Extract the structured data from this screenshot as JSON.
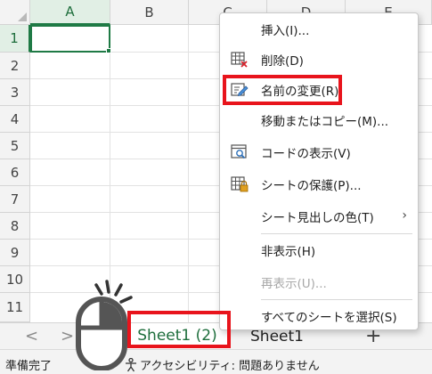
{
  "columns": [
    "A",
    "B",
    "C",
    "D",
    "E"
  ],
  "rows": [
    "1",
    "2",
    "3",
    "4",
    "5",
    "6",
    "7",
    "8",
    "9",
    "10",
    "11"
  ],
  "active_cell": "A1",
  "sheet_tabs": {
    "nav_prev": "<",
    "nav_next": ">",
    "active_tab": "Sheet1 (2)",
    "other_tab": "Sheet1",
    "add_label": "+"
  },
  "status_bar": {
    "ready": "準備完了",
    "accessibility": "アクセシビリティ: 問題ありません"
  },
  "context_menu": {
    "items": [
      {
        "label": "挿入(I)...",
        "icon": "none",
        "enabled": true
      },
      {
        "label": "削除(D)",
        "icon": "delete-sheet-icon",
        "enabled": true
      },
      {
        "label": "名前の変更(R)",
        "icon": "rename-icon",
        "enabled": true
      },
      {
        "label": "移動またはコピー(M)...",
        "icon": "none",
        "enabled": true
      },
      {
        "label": "コードの表示(V)",
        "icon": "view-code-icon",
        "enabled": true
      },
      {
        "label": "シートの保護(P)...",
        "icon": "protect-sheet-icon",
        "enabled": true
      },
      {
        "label": "シート見出しの色(T)",
        "icon": "none",
        "enabled": true,
        "submenu": true
      },
      {
        "label": "非表示(H)",
        "icon": "none",
        "enabled": true
      },
      {
        "label": "再表示(U)...",
        "icon": "none",
        "enabled": false
      },
      {
        "label": "すべてのシートを選択(S)",
        "icon": "none",
        "enabled": true
      }
    ],
    "submenu_arrow": "›"
  },
  "colors": {
    "excel_green": "#1f7a45",
    "highlight_red": "#e8141c",
    "header_bg": "#f3f3f3",
    "disabled_text": "#a8a8a8"
  }
}
